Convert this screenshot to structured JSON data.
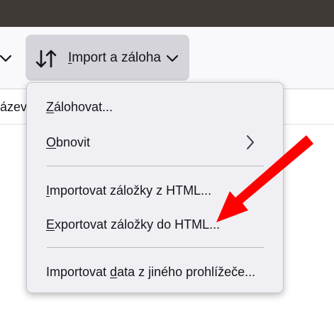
{
  "toolbar": {
    "import_backup_button": {
      "label_mnemonic": "I",
      "label_rest": "mport a záloha"
    }
  },
  "table_header": {
    "column_label_partial": "ázev"
  },
  "menu": {
    "items": [
      {
        "mnemonic": "Z",
        "rest": "álohovat..."
      },
      {
        "mnemonic": "O",
        "rest": "bnovit"
      },
      {
        "mnemonic": "I",
        "rest": "mportovat záložky z HTML..."
      },
      {
        "mnemonic": "E",
        "rest": "xportovat záložky do HTML..."
      },
      {
        "pre": "Importovat ",
        "mnemonic": "d",
        "rest": "ata z jiného prohlížeče..."
      }
    ]
  },
  "annotation": {
    "arrow_color": "#ff0000"
  },
  "colors": {
    "titlebar": "#403a36",
    "toolbar": "#f9f9fb",
    "button_active": "#d4d4da",
    "menu_background": "#f0f0f4"
  },
  "icons": [
    "chevron-down-icon",
    "sort-arrows-icon",
    "chevron-right-icon",
    "red-arrow-annotation"
  ]
}
